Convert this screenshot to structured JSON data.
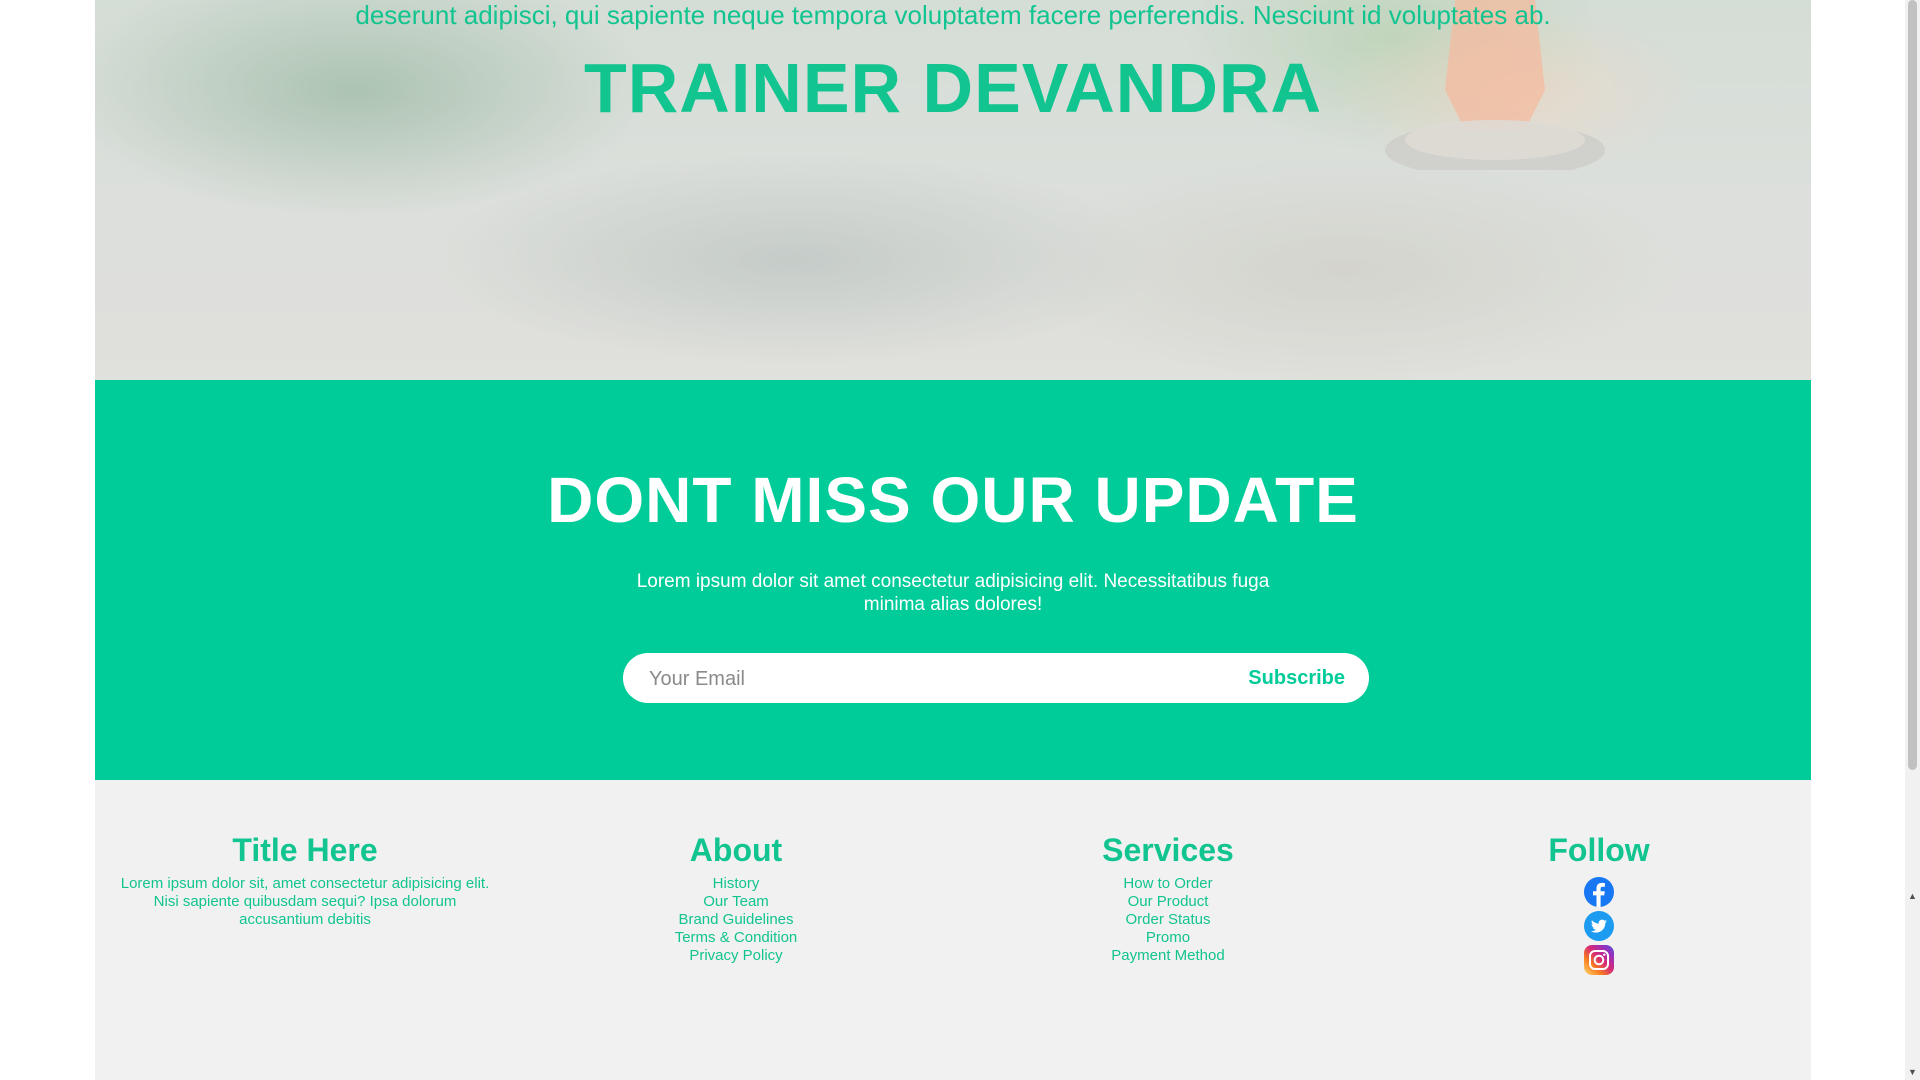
{
  "hero": {
    "paragraph_tail": "deserunt adipisci, qui sapiente neque tempora voluptatem facere perferendis. Nesciunt id voluptates ab.",
    "trainer_name": "TRAINER DEVANDRA"
  },
  "newsletter": {
    "title": "DONT MISS OUR UPDATE",
    "description": "Lorem ipsum dolor sit amet consectetur adipisicing elit. Necessitatibus fuga minima alias dolores!",
    "email_placeholder": "Your Email",
    "subscribe_label": "Subscribe"
  },
  "footer": {
    "col1": {
      "title": "Title Here",
      "text": "Lorem ipsum dolor sit, amet consectetur adipisicing elit. Nisi sapiente quibusdam sequi? Ipsa dolorum accusantium debitis"
    },
    "about": {
      "title": "About",
      "links": [
        "History",
        "Our Team",
        "Brand Guidelines",
        "Terms & Condition",
        "Privacy Policy"
      ]
    },
    "services": {
      "title": "Services",
      "links": [
        "How to Order",
        "Our Product",
        "Order Status",
        "Promo",
        "Payment Method"
      ]
    },
    "follow": {
      "title": "Follow",
      "icons": [
        "facebook-icon",
        "twitter-icon",
        "instagram-icon"
      ]
    }
  },
  "colors": {
    "accent": "#00cc99",
    "accent_text": "#12c48f",
    "footer_bg": "#f1f1f1",
    "facebook": "#1877f2",
    "twitter": "#1d9bf0"
  }
}
